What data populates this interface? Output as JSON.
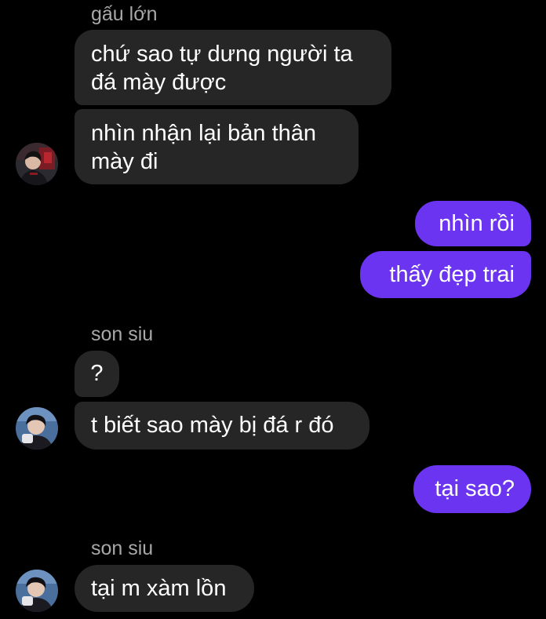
{
  "messages": {
    "group1": {
      "sender": "gấu lớn",
      "bubble1": "chứ sao tự dưng người ta\nđá mày được",
      "bubble2": "nhìn nhận lại bản thân\nmày đi",
      "avatar_icon": "user-avatar-icon"
    },
    "outgoing1": {
      "bubble1": "nhìn rồi",
      "bubble2": "thấy đẹp trai"
    },
    "group2": {
      "sender": "son siu",
      "bubble1": "?",
      "bubble2": "t biết sao mày bị đá r đó",
      "avatar_icon": "user-avatar-icon"
    },
    "outgoing2": {
      "bubble1": "tại sao?"
    },
    "group3": {
      "sender": "son siu",
      "bubble1": "tại m xàm lồn",
      "avatar_icon": "user-avatar-icon"
    }
  },
  "colors": {
    "background": "#000000",
    "incoming_bubble": "#262626",
    "outgoing_bubble": "#6a34f0",
    "sender_name": "#a8a8a8",
    "text": "#ffffff"
  }
}
